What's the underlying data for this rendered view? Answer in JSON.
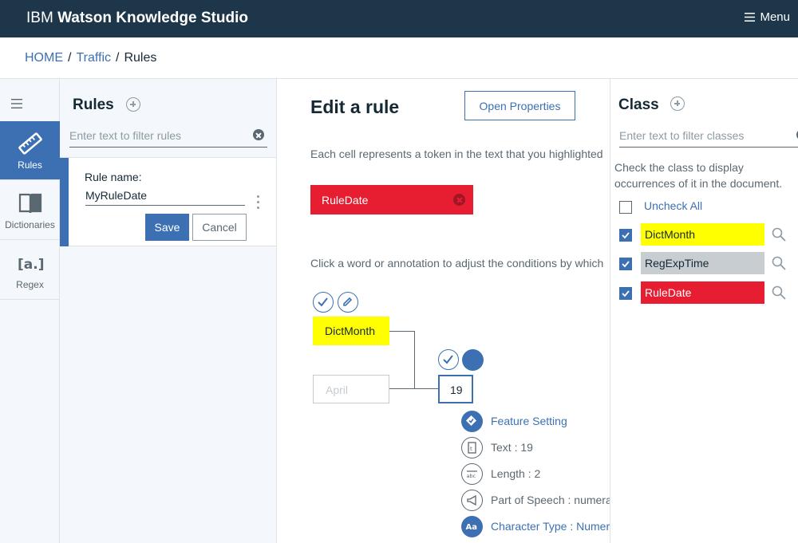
{
  "app": {
    "brand_prefix": "IBM",
    "brand_name": "Watson Knowledge Studio",
    "menu_label": "Menu"
  },
  "breadcrumb": {
    "home": "HOME",
    "project": "Traffic",
    "current": "Rules",
    "separator": "/"
  },
  "leftnav": {
    "items": [
      {
        "label": "Rules",
        "icon": "ruler-icon",
        "active": true
      },
      {
        "label": "Dictionaries",
        "icon": "book-icon",
        "active": false
      },
      {
        "label": "Regex",
        "icon": "regex-icon",
        "active": false
      }
    ]
  },
  "rules_panel": {
    "title": "Rules",
    "filter_placeholder": "Enter text to filter rules",
    "rule_name_label": "Rule name:",
    "rule_name_value": "MyRuleDate",
    "save_label": "Save",
    "cancel_label": "Cancel"
  },
  "editor": {
    "title": "Edit a rule",
    "open_properties_label": "Open Properties",
    "description": "Each cell represents a token in the text that you highlighted",
    "rule_tag": "RuleDate",
    "instruction": "Click a word or annotation to adjust the conditions by which",
    "tokens": {
      "annotation": "DictMonth",
      "word": "April",
      "number": "19"
    },
    "properties": [
      {
        "text": "Feature Setting",
        "icon": "feature-setting-icon",
        "style": "link"
      },
      {
        "text": "Text : 19",
        "icon": "text-icon",
        "style": "plain"
      },
      {
        "text": "Length : 2",
        "icon": "length-icon",
        "style": "plain"
      },
      {
        "text": "Part of Speech : numeral",
        "icon": "megaphone-icon",
        "style": "plain"
      },
      {
        "text": "Character Type : Numeric",
        "icon": "character-type-icon",
        "style": "link"
      }
    ]
  },
  "class_panel": {
    "title": "Class",
    "filter_placeholder": "Enter text to filter classes",
    "description": "Check the class to display occurrences of it in the document.",
    "uncheck_all_label": "Uncheck All",
    "classes": [
      {
        "name": "DictMonth",
        "color": "#ffff00",
        "checked": true
      },
      {
        "name": "RegExpTime",
        "color": "#c7cdd1",
        "checked": true
      },
      {
        "name": "RuleDate",
        "color": "#e71d32",
        "checked": true
      }
    ]
  },
  "colors": {
    "topbar": "#1d3649",
    "accent": "#3d70b2",
    "rule_red": "#e71d32",
    "highlight_yellow": "#ffff00"
  }
}
